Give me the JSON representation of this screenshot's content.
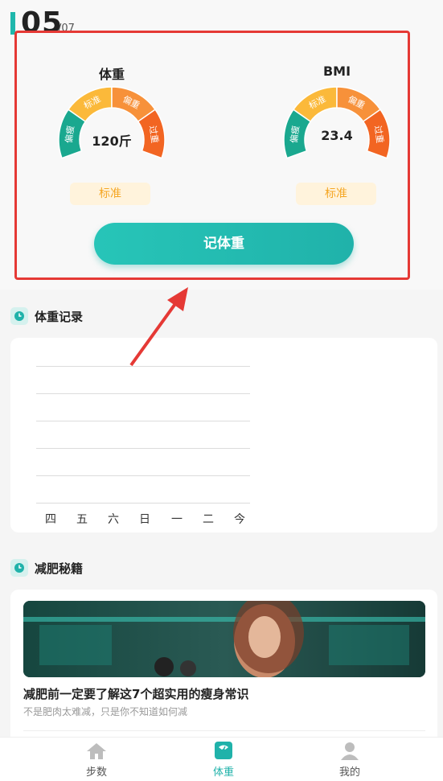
{
  "header": {
    "day": "05",
    "month": "/07"
  },
  "gauges": {
    "weight": {
      "title": "体重",
      "value": "120斤",
      "status": "标准",
      "segments": [
        "偏瘦",
        "标准",
        "偏重",
        "过重"
      ]
    },
    "bmi": {
      "title": "BMI",
      "value": "23.4",
      "status": "标准",
      "segments": [
        "偏瘦",
        "标准",
        "偏重",
        "过重"
      ]
    }
  },
  "cta": {
    "label": "记体重"
  },
  "records": {
    "title": "体重记录",
    "days": [
      "四",
      "五",
      "六",
      "日",
      "一",
      "二",
      "今"
    ]
  },
  "tips": {
    "title": "减肥秘籍",
    "article": {
      "title": "减肥前一定要了解这7个超实用的瘦身常识",
      "subtitle": "不是肥肉太难减，只是你不知道如何减"
    }
  },
  "tabs": [
    {
      "label": "步数",
      "icon": "home-icon",
      "active": false
    },
    {
      "label": "体重",
      "icon": "scale-icon",
      "active": true
    },
    {
      "label": "我的",
      "icon": "user-icon",
      "active": false
    }
  ],
  "colors": {
    "accent": "#20b2aa",
    "thin": "#1aa88f",
    "normal": "#fbb93a",
    "heavy": "#f7913a",
    "over": "#f26522",
    "highlight": "#e53935"
  }
}
